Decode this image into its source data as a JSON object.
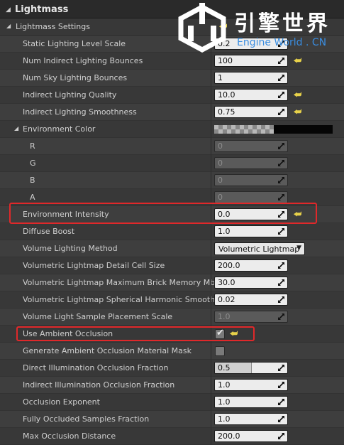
{
  "panel": {
    "title": "Lightmass",
    "section": "Lightmass Settings"
  },
  "watermark": {
    "text_cn": "引擎世界",
    "text_en": "Engine World . CN",
    "color_en": "#3a8de0"
  },
  "rows": [
    {
      "label": "Static Lighting Level Scale",
      "indent": 1,
      "type": "number",
      "value": "0.2",
      "reset": false
    },
    {
      "label": "Num Indirect Lighting Bounces",
      "indent": 1,
      "type": "number",
      "value": "100",
      "reset": true
    },
    {
      "label": "Num Sky Lighting Bounces",
      "indent": 1,
      "type": "number",
      "value": "1",
      "reset": false
    },
    {
      "label": "Indirect Lighting Quality",
      "indent": 1,
      "type": "number",
      "value": "10.0",
      "reset": true
    },
    {
      "label": "Indirect Lighting Smoothness",
      "indent": 1,
      "type": "number",
      "value": "0.75",
      "reset": true
    },
    {
      "label": "Environment Color",
      "indent": 1,
      "type": "color",
      "expanded": true,
      "reset": false
    },
    {
      "label": "R",
      "indent": 2,
      "type": "number",
      "value": "0",
      "disabled": true,
      "reset": false
    },
    {
      "label": "G",
      "indent": 2,
      "type": "number",
      "value": "0",
      "disabled": true,
      "reset": false
    },
    {
      "label": "B",
      "indent": 2,
      "type": "number",
      "value": "0",
      "disabled": true,
      "reset": false
    },
    {
      "label": "A",
      "indent": 2,
      "type": "number",
      "value": "0",
      "disabled": true,
      "reset": false
    },
    {
      "label": "Environment Intensity",
      "indent": 1,
      "type": "number",
      "value": "0.0",
      "reset": true
    },
    {
      "label": "Diffuse Boost",
      "indent": 1,
      "type": "number",
      "value": "1.0",
      "reset": false
    },
    {
      "label": "Volume Lighting Method",
      "indent": 1,
      "type": "dropdown",
      "value": "Volumetric Lightmap",
      "reset": false
    },
    {
      "label": "Volumetric Lightmap Detail Cell Size",
      "indent": 1,
      "type": "number",
      "value": "200.0",
      "reset": false
    },
    {
      "label": "Volumetric Lightmap Maximum Brick Memory Mb",
      "indent": 1,
      "type": "number",
      "value": "30.0",
      "reset": false
    },
    {
      "label": "Volumetric Lightmap Spherical Harmonic Smoothing",
      "indent": 1,
      "type": "number",
      "value": "0.02",
      "reset": false
    },
    {
      "label": "Volume Light Sample Placement Scale",
      "indent": 1,
      "type": "number",
      "value": "1.0",
      "disabled": true,
      "reset": false
    },
    {
      "label": "Use Ambient Occlusion",
      "indent": 1,
      "type": "checkbox",
      "checked": true,
      "reset": true
    },
    {
      "label": "Generate Ambient Occlusion Material Mask",
      "indent": 1,
      "type": "checkbox",
      "checked": false,
      "reset": false
    },
    {
      "label": "Direct Illumination Occlusion Fraction",
      "indent": 1,
      "type": "number",
      "value": "0.5",
      "fill": 0.5,
      "reset": false
    },
    {
      "label": "Indirect Illumination Occlusion Fraction",
      "indent": 1,
      "type": "number",
      "value": "1.0",
      "reset": false
    },
    {
      "label": "Occlusion Exponent",
      "indent": 1,
      "type": "number",
      "value": "1.0",
      "reset": false
    },
    {
      "label": "Fully Occluded Samples Fraction",
      "indent": 1,
      "type": "number",
      "value": "1.0",
      "reset": false
    },
    {
      "label": "Max Occlusion Distance",
      "indent": 1,
      "type": "number",
      "value": "200.0",
      "reset": false
    }
  ],
  "highlights": [
    "Environment Intensity",
    "Use Ambient Occlusion"
  ],
  "colors": {
    "highlight": "#e0282a",
    "reset_arrow": "#e8d24a",
    "panel_bg": "#3a3a3a"
  }
}
